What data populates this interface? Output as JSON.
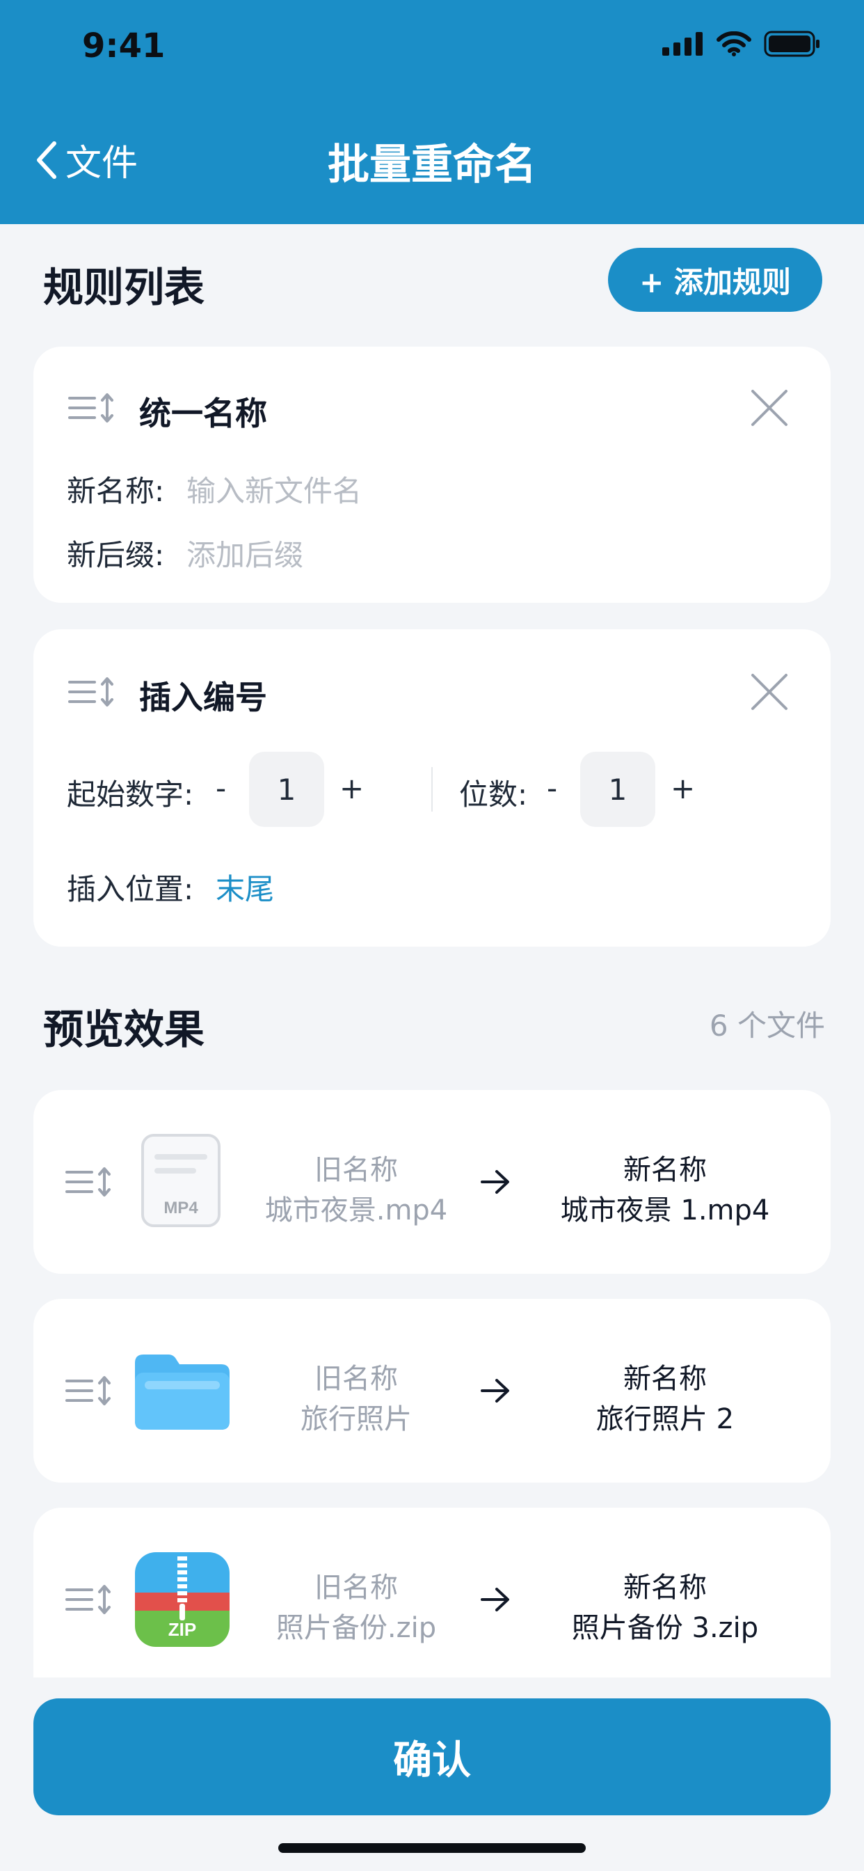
{
  "status": {
    "time": "9:41"
  },
  "nav": {
    "back_label": "文件",
    "title": "批量重命名"
  },
  "rules": {
    "section_title": "规则列表",
    "add_button": "+ 添加规则",
    "rule1": {
      "title": "统一名称",
      "name_label": "新名称:",
      "name_placeholder": "输入新文件名",
      "suffix_label": "新后缀:",
      "suffix_placeholder": "添加后缀"
    },
    "rule2": {
      "title": "插入编号",
      "start_label": "起始数字:",
      "start_value": "1",
      "digits_label": "位数:",
      "digits_value": "1",
      "minus": "-",
      "plus": "+",
      "position_label": "插入位置:",
      "position_value": "末尾"
    }
  },
  "preview": {
    "section_title": "预览效果",
    "count": "6 个文件",
    "old_label": "旧名称",
    "new_label": "新名称",
    "items": [
      {
        "type_icon": "mp4-file-icon",
        "badge": "MP4",
        "old_name": "城市夜景.mp4",
        "new_name": "城市夜景 1.mp4"
      },
      {
        "type_icon": "folder-icon",
        "old_name": "旅行照片",
        "new_name": "旅行照片 2"
      },
      {
        "type_icon": "zip-file-icon",
        "badge": "ZIP",
        "old_name": "照片备份.zip",
        "new_name": "照片备份 3.zip"
      }
    ]
  },
  "confirm_label": "确认",
  "colors": {
    "accent": "#1b8ec7",
    "background": "#f3f5f8"
  }
}
